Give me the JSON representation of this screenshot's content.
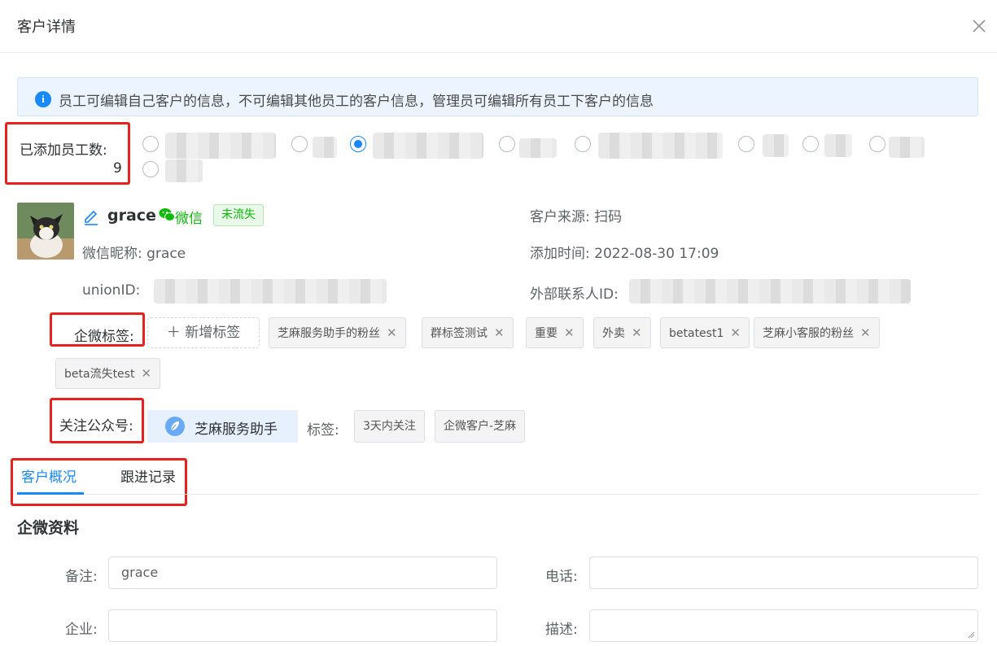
{
  "dialog": {
    "title": "客户详情"
  },
  "notice": {
    "text": "员工可编辑自己客户的信息，不可编辑其他员工的客户信息，管理员可编辑所有员工下客户的信息"
  },
  "staff": {
    "label": "已添加员工数:",
    "count": "9"
  },
  "customer": {
    "name": "grace",
    "wechat_label": "微信",
    "status": "未流失",
    "nickname_label": "微信昵称:",
    "nickname": "grace",
    "unionid_label": "unionID:",
    "source_label": "客户来源:",
    "source": "扫码",
    "add_time_label": "添加时间:",
    "add_time": "2022-08-30 17:09",
    "external_id_label": "外部联系人ID:"
  },
  "tags": {
    "label": "企微标签:",
    "add_label": "新增标签",
    "items": [
      "芝麻服务助手的粉丝",
      "群标签测试",
      "重要",
      "外卖",
      "betatest1",
      "芝麻小客服的粉丝",
      "beta流失test"
    ]
  },
  "official_account": {
    "label": "关注公众号:",
    "name": "芝麻服务助手",
    "tags_label": "标签:",
    "tags": [
      "3天内关注",
      "企微客户-芝麻"
    ]
  },
  "tabs": [
    {
      "label": "客户概况"
    },
    {
      "label": "跟进记录"
    }
  ],
  "profile": {
    "title": "企微资料",
    "remark_label": "备注:",
    "remark_value": "grace",
    "phone_label": "电话:",
    "company_label": "企业:",
    "desc_label": "描述:"
  },
  "colors": {
    "primary": "#1989fa",
    "wechat": "#09bb07",
    "highlight": "#e8211d"
  }
}
